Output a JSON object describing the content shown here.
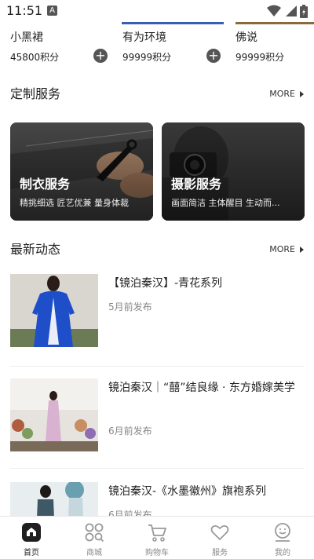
{
  "status_bar": {
    "time": "11:51",
    "notification": "A"
  },
  "products": [
    {
      "name": "小黑裙",
      "points": "45800积分"
    },
    {
      "name": "有为环境",
      "points": "99999积分"
    },
    {
      "name": "佛说",
      "points": "99999积分"
    }
  ],
  "custom_services": {
    "title": "定制服务",
    "more_label": "MORE",
    "cards": [
      {
        "title": "制衣服务",
        "subtitle": "精挑细选 匠艺优兼 量身体裁"
      },
      {
        "title": "摄影服务",
        "subtitle": "画面简洁 主体醒目 生动而..."
      }
    ]
  },
  "news": {
    "title": "最新动态",
    "more_label": "MORE",
    "items": [
      {
        "title": "【镜泊秦汉】-青花系列",
        "time": "5月前发布"
      },
      {
        "title": "镜泊秦汉｜“囍”结良缘 · 东方婚嫁美学",
        "time": "6月前发布"
      },
      {
        "title": "镜泊秦汉-《水墨徽州》旗袍系列",
        "time": "6月前发布"
      }
    ]
  },
  "tabs": [
    {
      "label": "首页",
      "icon": "home-icon",
      "active": true
    },
    {
      "label": "商城",
      "icon": "shop-icon",
      "active": false
    },
    {
      "label": "购物车",
      "icon": "cart-icon",
      "active": false
    },
    {
      "label": "服务",
      "icon": "heart-icon",
      "active": false
    },
    {
      "label": "我的",
      "icon": "profile-icon",
      "active": false
    }
  ],
  "colors": {
    "accent": "#333333",
    "text": "#222222",
    "muted": "#888888"
  }
}
